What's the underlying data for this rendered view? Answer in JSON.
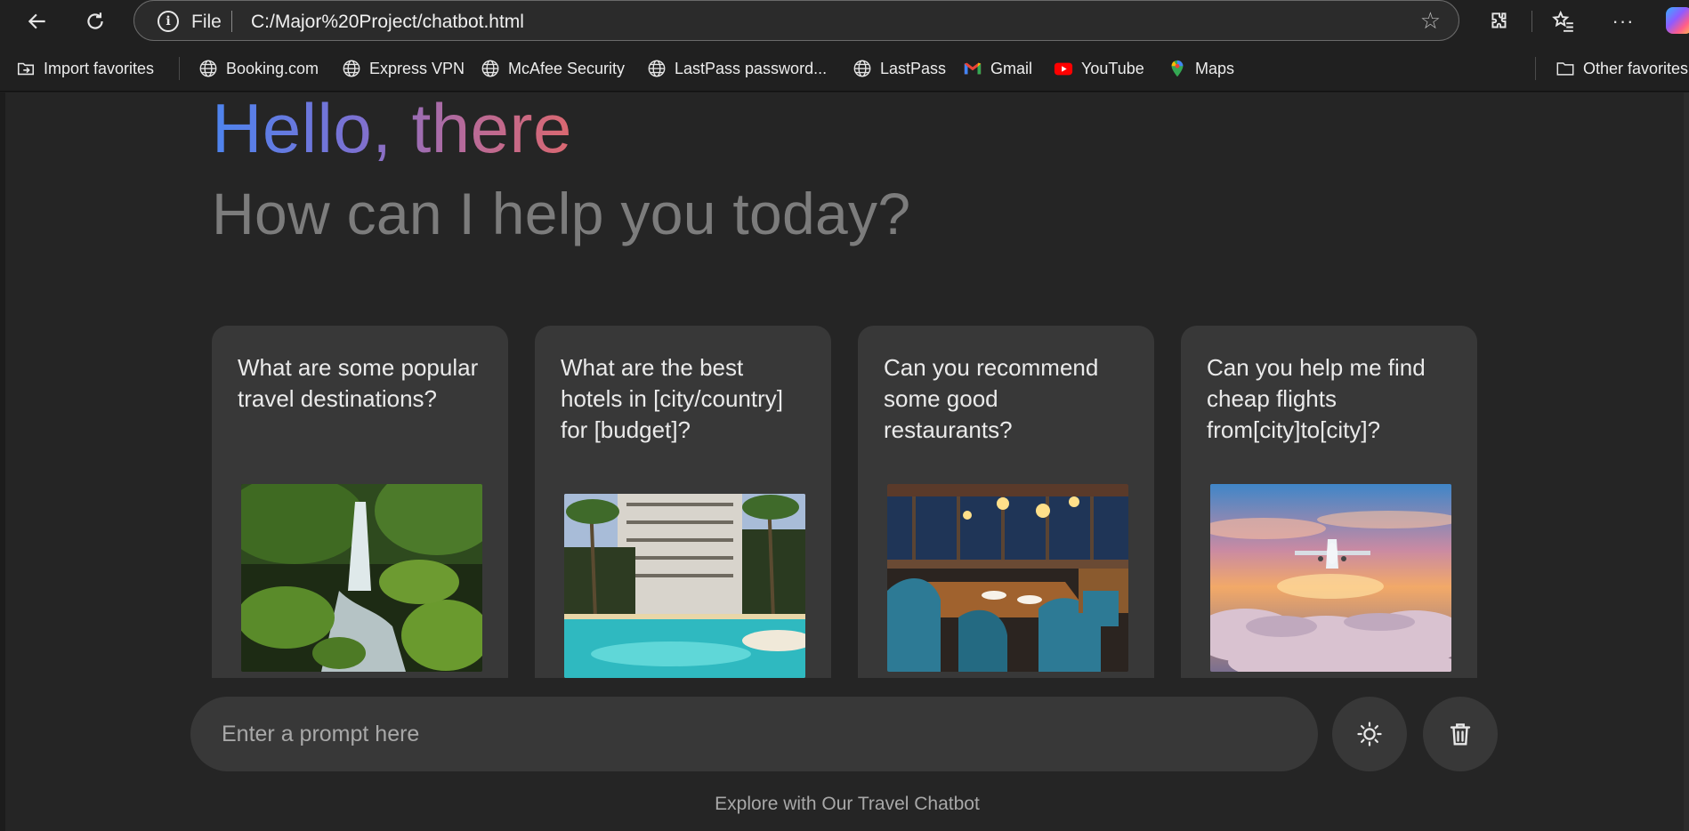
{
  "browser": {
    "address": {
      "scheme_label": "File",
      "url": "C:/Major%20Project/chatbot.html"
    },
    "favorites": [
      {
        "label": "Import favorites",
        "icon": "import-icon"
      },
      {
        "label": "Booking.com",
        "icon": "globe-icon"
      },
      {
        "label": "Express VPN",
        "icon": "globe-icon"
      },
      {
        "label": "McAfee Security",
        "icon": "globe-icon"
      },
      {
        "label": "LastPass password...",
        "icon": "globe-icon"
      },
      {
        "label": "LastPass",
        "icon": "globe-icon"
      },
      {
        "label": "Gmail",
        "icon": "gmail-icon"
      },
      {
        "label": "YouTube",
        "icon": "youtube-icon"
      },
      {
        "label": "Maps",
        "icon": "maps-icon"
      },
      {
        "label": "Other favorites",
        "icon": "folder-icon"
      }
    ]
  },
  "header": {
    "greeting": "Hello, there",
    "subtitle": "How can I help you today?"
  },
  "suggestions": [
    {
      "text": "What are some popular travel destinations?",
      "image": "waterfall-forest-photo"
    },
    {
      "text": "What are the best hotels in [city/country] for [budget]?",
      "image": "hotel-pool-photo"
    },
    {
      "text": "Can you recommend some good restaurants?",
      "image": "restaurant-interior-photo"
    },
    {
      "text": "Can you help me find cheap flights from[city]to[city]?",
      "image": "airplane-sunset-photo"
    }
  ],
  "prompt": {
    "placeholder": "Enter a prompt here"
  },
  "actions": {
    "theme": "sun-icon",
    "delete": "trash-icon"
  },
  "footer": {
    "text": "Explore with Our Travel Chatbot"
  },
  "colors": {
    "page_bg": "#252525",
    "card_bg": "#383838",
    "gradient_start": "#4d84ef",
    "gradient_end": "#da6870",
    "muted_text": "#7c7c7c"
  }
}
